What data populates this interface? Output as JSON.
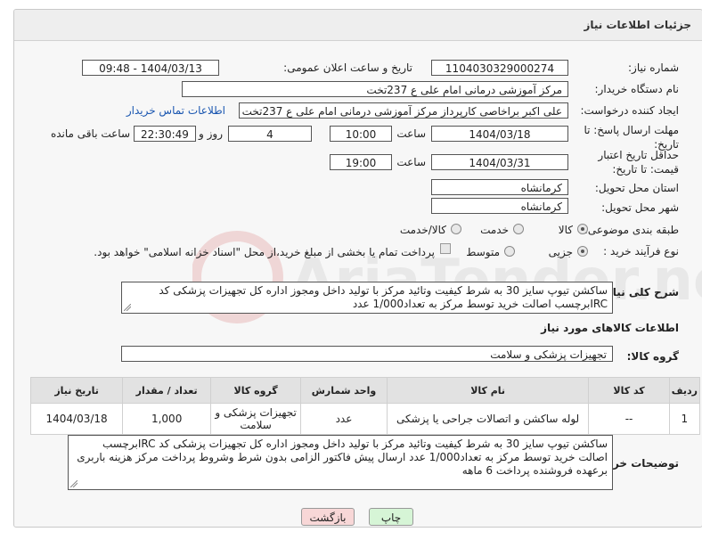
{
  "header": {
    "title": "جزئیات اطلاعات نیاز"
  },
  "labels": {
    "need_number": "شماره نیاز:",
    "announce_datetime": "تاریخ و ساعت اعلان عمومی:",
    "buyer_org": "نام دستگاه خریدار:",
    "requester": "ایجاد کننده درخواست:",
    "reply_deadline": "مهلت ارسال پاسخ: تا تاریخ:",
    "price_validity": "حداقل تاریخ اعتبار قیمت: تا تاریخ:",
    "delivery_province": "استان محل تحویل:",
    "delivery_city": "شهر محل تحویل:",
    "category": "طبقه بندی موضوعی:",
    "process_type": "نوع فرآیند خرید :",
    "time": "ساعت",
    "day_and": "روز و",
    "remaining": "ساعت باقی مانده",
    "general_desc": "شرح کلی نیاز:",
    "items_info": "اطلاعات کالاهای مورد نیاز",
    "goods_group": "گروه کالا:",
    "buyer_notes": "توضیحات خریدار:"
  },
  "fields": {
    "need_number": "1104030329000274",
    "announce_datetime": "1404/03/13 - 09:48",
    "buyer_org": "مرکز آموزشی درمانی امام علی ع 237تخت",
    "requester": "علی اکبر براخاصی کارپرداز  مرکز آموزشی درمانی امام علی ع 237تخت",
    "contact_link": "اطلاعات تماس خریدار",
    "reply_date": "1404/03/18",
    "reply_time": "10:00",
    "reply_days": "4",
    "reply_remaining": "22:30:49",
    "validity_date": "1404/03/31",
    "validity_time": "19:00",
    "province": "کرمانشاه",
    "city": "کرمانشاه",
    "goods_group": "تجهیزات پزشکی و سلامت"
  },
  "category_options": [
    {
      "label": "کالا",
      "selected": true
    },
    {
      "label": "خدمت",
      "selected": false
    },
    {
      "label": "کالا/خدمت",
      "selected": false
    }
  ],
  "process_options": [
    {
      "label": "جزیی",
      "selected": true
    },
    {
      "label": "متوسط",
      "selected": false
    }
  ],
  "payment_note": "پرداخت تمام یا بخشی از مبلغ خرید،از محل \"اسناد خزانه اسلامی\" خواهد بود.",
  "general_desc_text": "ساکشن تیوپ سایز 30 به شرط کیفیت وتائید مرکز با تولید داخل ومجوز اداره کل تجهیزات پزشکی  کد IRCبرچسب اصالت خرید توسط مرکز به تعداد1/000 عدد",
  "table": {
    "headers": [
      "ردیف",
      "کد کالا",
      "نام کالا",
      "واحد شمارش",
      "گروه کالا",
      "تعداد / مقدار",
      "تاریخ نیاز"
    ],
    "rows": [
      [
        "1",
        "--",
        "لوله ساکشن و اتصالات جراحی یا پزشکی",
        "عدد",
        "تجهیزات پزشکی و سلامت",
        "1,000",
        "1404/03/18"
      ]
    ]
  },
  "buyer_notes_text": "ساکشن تیوپ سایز 30 به شرط کیفیت وتائید مرکز با تولید داخل ومجوز اداره کل تجهیزات پزشکی  کد IRCبرچسب اصالت خرید توسط مرکز به تعداد1/000 عدد ارسال پیش فاکتور الزامی  بدون شرط وشروط پرداخت مرکز هزینه باربری برعهده فروشنده پرداخت 6 ماهه",
  "buttons": {
    "print": "چاپ",
    "back": "بازگشت"
  },
  "watermark": {
    "text": "AriaTender.neT"
  },
  "colors": {
    "link": "#1a56b0",
    "print_bg": "#d6f5d6",
    "back_bg": "#f8d7d7",
    "table_header_bg": "#e2e2e2"
  }
}
